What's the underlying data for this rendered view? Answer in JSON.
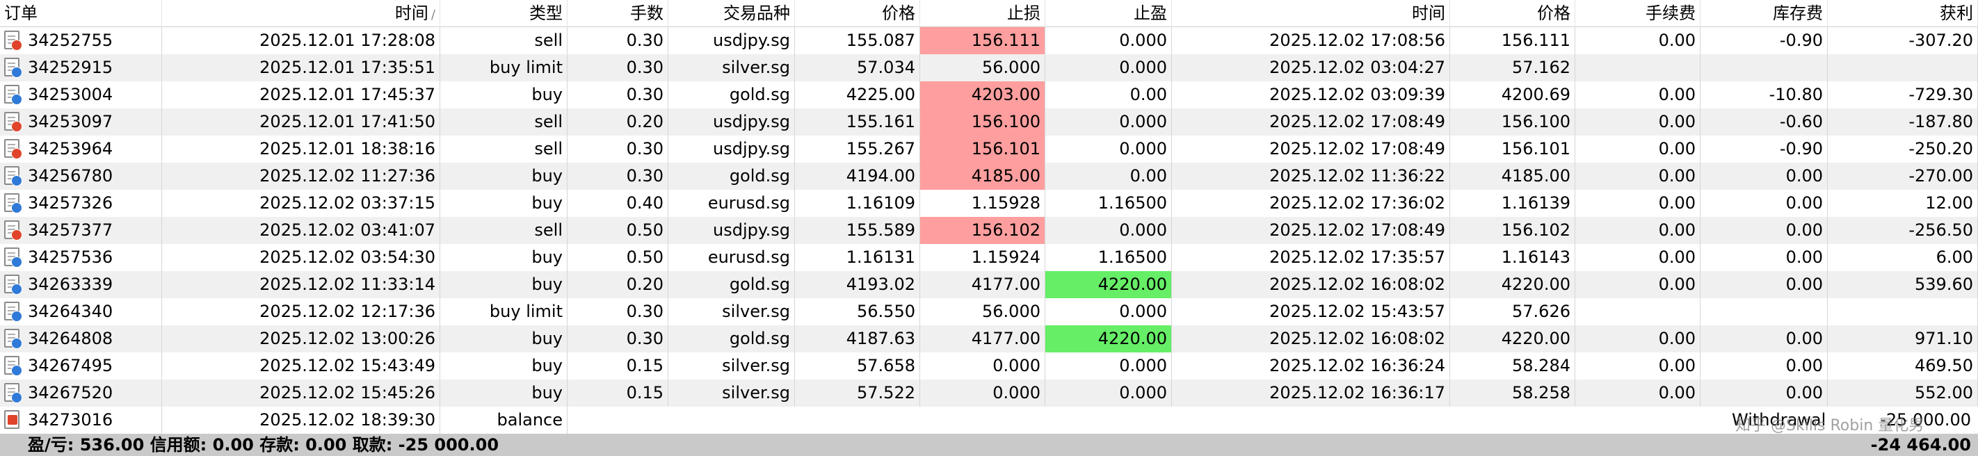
{
  "columns": [
    "订单",
    "时间",
    "类型",
    "手数",
    "交易品种",
    "价格",
    "止损",
    "止盈",
    "时间",
    "价格",
    "手续费",
    "库存费",
    "获利"
  ],
  "sort_indicator": "/",
  "rows": [
    {
      "order": "34252755",
      "time": "2025.12.01 17:28:08",
      "type": "sell",
      "volume": "0.30",
      "symbol": "usdjpy.sg",
      "price": "155.087",
      "sl": "156.111",
      "tp": "0.000",
      "ctime": "2025.12.02 17:08:56",
      "cprice": "156.111",
      "commission": "0.00",
      "swap": "-0.90",
      "profit": "-307.20",
      "sl_hl": "red",
      "tp_hl": ""
    },
    {
      "order": "34252915",
      "time": "2025.12.01 17:35:51",
      "type": "buy limit",
      "volume": "0.30",
      "symbol": "silver.sg",
      "price": "57.034",
      "sl": "56.000",
      "tp": "0.000",
      "ctime": "2025.12.02 03:04:27",
      "cprice": "57.162",
      "commission": "",
      "swap": "",
      "profit": "",
      "sl_hl": "",
      "tp_hl": ""
    },
    {
      "order": "34253004",
      "time": "2025.12.01 17:45:37",
      "type": "buy",
      "volume": "0.30",
      "symbol": "gold.sg",
      "price": "4225.00",
      "sl": "4203.00",
      "tp": "0.00",
      "ctime": "2025.12.02 03:09:39",
      "cprice": "4200.69",
      "commission": "0.00",
      "swap": "-10.80",
      "profit": "-729.30",
      "sl_hl": "red",
      "tp_hl": ""
    },
    {
      "order": "34253097",
      "time": "2025.12.01 17:41:50",
      "type": "sell",
      "volume": "0.20",
      "symbol": "usdjpy.sg",
      "price": "155.161",
      "sl": "156.100",
      "tp": "0.000",
      "ctime": "2025.12.02 17:08:49",
      "cprice": "156.100",
      "commission": "0.00",
      "swap": "-0.60",
      "profit": "-187.80",
      "sl_hl": "red",
      "tp_hl": ""
    },
    {
      "order": "34253964",
      "time": "2025.12.01 18:38:16",
      "type": "sell",
      "volume": "0.30",
      "symbol": "usdjpy.sg",
      "price": "155.267",
      "sl": "156.101",
      "tp": "0.000",
      "ctime": "2025.12.02 17:08:49",
      "cprice": "156.101",
      "commission": "0.00",
      "swap": "-0.90",
      "profit": "-250.20",
      "sl_hl": "red",
      "tp_hl": ""
    },
    {
      "order": "34256780",
      "time": "2025.12.02 11:27:36",
      "type": "buy",
      "volume": "0.30",
      "symbol": "gold.sg",
      "price": "4194.00",
      "sl": "4185.00",
      "tp": "0.00",
      "ctime": "2025.12.02 11:36:22",
      "cprice": "4185.00",
      "commission": "0.00",
      "swap": "0.00",
      "profit": "-270.00",
      "sl_hl": "red",
      "tp_hl": ""
    },
    {
      "order": "34257326",
      "time": "2025.12.02 03:37:15",
      "type": "buy",
      "volume": "0.40",
      "symbol": "eurusd.sg",
      "price": "1.16109",
      "sl": "1.15928",
      "tp": "1.16500",
      "ctime": "2025.12.02 17:36:02",
      "cprice": "1.16139",
      "commission": "0.00",
      "swap": "0.00",
      "profit": "12.00",
      "sl_hl": "",
      "tp_hl": ""
    },
    {
      "order": "34257377",
      "time": "2025.12.02 03:41:07",
      "type": "sell",
      "volume": "0.50",
      "symbol": "usdjpy.sg",
      "price": "155.589",
      "sl": "156.102",
      "tp": "0.000",
      "ctime": "2025.12.02 17:08:49",
      "cprice": "156.102",
      "commission": "0.00",
      "swap": "0.00",
      "profit": "-256.50",
      "sl_hl": "red",
      "tp_hl": ""
    },
    {
      "order": "34257536",
      "time": "2025.12.02 03:54:30",
      "type": "buy",
      "volume": "0.50",
      "symbol": "eurusd.sg",
      "price": "1.16131",
      "sl": "1.15924",
      "tp": "1.16500",
      "ctime": "2025.12.02 17:35:57",
      "cprice": "1.16143",
      "commission": "0.00",
      "swap": "0.00",
      "profit": "6.00",
      "sl_hl": "",
      "tp_hl": ""
    },
    {
      "order": "34263339",
      "time": "2025.12.02 11:33:14",
      "type": "buy",
      "volume": "0.20",
      "symbol": "gold.sg",
      "price": "4193.02",
      "sl": "4177.00",
      "tp": "4220.00",
      "ctime": "2025.12.02 16:08:02",
      "cprice": "4220.00",
      "commission": "0.00",
      "swap": "0.00",
      "profit": "539.60",
      "sl_hl": "",
      "tp_hl": "green"
    },
    {
      "order": "34264340",
      "time": "2025.12.02 12:17:36",
      "type": "buy limit",
      "volume": "0.30",
      "symbol": "silver.sg",
      "price": "56.550",
      "sl": "56.000",
      "tp": "0.000",
      "ctime": "2025.12.02 15:43:57",
      "cprice": "57.626",
      "commission": "",
      "swap": "",
      "profit": "",
      "sl_hl": "",
      "tp_hl": ""
    },
    {
      "order": "34264808",
      "time": "2025.12.02 13:00:26",
      "type": "buy",
      "volume": "0.30",
      "symbol": "gold.sg",
      "price": "4187.63",
      "sl": "4177.00",
      "tp": "4220.00",
      "ctime": "2025.12.02 16:08:02",
      "cprice": "4220.00",
      "commission": "0.00",
      "swap": "0.00",
      "profit": "971.10",
      "sl_hl": "",
      "tp_hl": "green"
    },
    {
      "order": "34267495",
      "time": "2025.12.02 15:43:49",
      "type": "buy",
      "volume": "0.15",
      "symbol": "silver.sg",
      "price": "57.658",
      "sl": "0.000",
      "tp": "0.000",
      "ctime": "2025.12.02 16:36:24",
      "cprice": "58.284",
      "commission": "0.00",
      "swap": "0.00",
      "profit": "469.50",
      "sl_hl": "",
      "tp_hl": ""
    },
    {
      "order": "34267520",
      "time": "2025.12.02 15:45:26",
      "type": "buy",
      "volume": "0.15",
      "symbol": "silver.sg",
      "price": "57.522",
      "sl": "0.000",
      "tp": "0.000",
      "ctime": "2025.12.02 16:36:17",
      "cprice": "58.258",
      "commission": "0.00",
      "swap": "0.00",
      "profit": "552.00",
      "sl_hl": "",
      "tp_hl": ""
    }
  ],
  "balance_row": {
    "order": "34273016",
    "time": "2025.12.02 18:39:30",
    "type": "balance",
    "label": "Withdrawal",
    "amount": "-25 000.00"
  },
  "footer": {
    "summary": "盈/亏: 536.00  信用额: 0.00  存款: 0.00  取款: -25 000.00",
    "total": "-24 464.00"
  },
  "watermark": "知乎 @Skills Robin 量化男",
  "colors": {
    "stop_loss_hit": "#ff9e9e",
    "take_profit_hit": "#66ee66",
    "footer_bg": "#c9c9c9",
    "row_alt": "#f0f0f0"
  },
  "icons": {
    "buy": "document-blue-dot-icon",
    "sell": "document-red-dot-icon",
    "balance": "document-red-arrow-icon"
  }
}
